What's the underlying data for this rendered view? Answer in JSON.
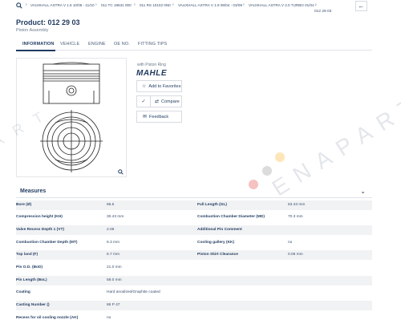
{
  "breadcrumb": {
    "items": [
      "VAUXHALL ASTRA V 1.6 10/06 - 11/10",
      "011 TC 18631 000",
      "011 RS 10102 0N0",
      "VAUXHALL ASTRA V 1.9 08/04 - 03/09",
      "VAUXHALL ASTRA V 2.0 TURBO 01/04 -",
      "012 29 03"
    ],
    "separator": "›",
    "back_icon": "back-arrow-icon"
  },
  "product": {
    "title": "Product: 012 29 03",
    "subtitle": "Piston Assembly"
  },
  "tabs": [
    "INFORMATION",
    "VEHICLE",
    "ENGINE",
    "OE NO.",
    "FITTING TIPS"
  ],
  "side": {
    "ring_label": "with Piston Ring",
    "brand": "MAHLE",
    "favorites": "Add to Favorites",
    "compare": "Compare",
    "feedback": "Feedback"
  },
  "watermark": {
    "left": "A R T",
    "right": "ENAPART"
  },
  "measures": {
    "title": "Measures",
    "rows": [
      [
        "Bore (Ø)",
        "86.5",
        "Full Length (GL)",
        "53.43 mm"
      ],
      [
        "Compression height (KH)",
        "30.43 mm",
        "Combustion Chamber Diameter (MD)",
        "70.3 mm"
      ],
      [
        "Valve Recess Depth 1 (VT)",
        "2.06",
        "Additional Pin Comment",
        ""
      ],
      [
        "Combustion Chamber Depth (MT)",
        "6.3 mm",
        "Cooling gallery (KK)",
        "no"
      ],
      [
        "Top land (F)",
        "6.7 mm",
        "Piston Skirt Clearance",
        "0.06 mm"
      ],
      [
        "Pin O.D. (BoD)",
        "21.0 mm",
        "",
        ""
      ],
      [
        "Pin Length (BoL)",
        "58.0 mm",
        "",
        ""
      ],
      [
        "Coating",
        "Hard anodized/Graphite coated",
        "",
        ""
      ],
      [
        "Casting Number ()",
        "86 P 47",
        "",
        ""
      ],
      [
        "Recess for oil cooling nozzle (AK)",
        "no",
        "",
        ""
      ]
    ]
  },
  "colors": {
    "primary": "#1f3a5f",
    "row_alt": "#f1f2f4",
    "dot_red": "#f6c1c1",
    "dot_gray": "#d9d9d9",
    "dot_yellow": "#fde6b8"
  }
}
